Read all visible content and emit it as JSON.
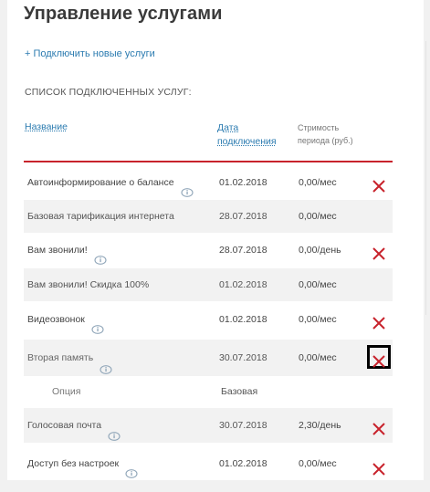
{
  "page": {
    "title": "Управление услугами",
    "add_link": "+ Подключить новые услуги",
    "list_title": "СПИСОК ПОДКЛЮЧЕННЫХ УСЛУГ:"
  },
  "table": {
    "headers": {
      "name": "Название",
      "date": "Дата подключения",
      "cost": "Стримость периода (руб.)"
    },
    "rows": [
      {
        "name": "Автоинформирование о балансе",
        "date": "01.02.2018",
        "cost": "0,00/мес"
      },
      {
        "name": "Базовая тарификация интернета",
        "date": "28.07.2018",
        "cost": "0,00/мес"
      },
      {
        "name": "Вам звонили!",
        "date": "28.07.2018",
        "cost": "0,00/день"
      },
      {
        "name": "Вам звонили! Скидка 100%",
        "date": "01.02.2018",
        "cost": "0,00/мес"
      },
      {
        "name": "Видеозвонок",
        "date": "01.02.2018",
        "cost": "0,00/мес"
      },
      {
        "name": "Вторая память",
        "date": "30.07.2018",
        "cost": "0,00/мес"
      },
      {
        "name": "Голосовая почта",
        "date": "30.07.2018",
        "cost": "2,30/день"
      },
      {
        "name": "Доступ без настроек",
        "date": "01.02.2018",
        "cost": "0,00/мес"
      }
    ],
    "option_row": {
      "label": "Опция",
      "value": "Базовая"
    }
  },
  "colors": {
    "accent_red": "#c8232c",
    "link_blue": "#2b7bb0"
  }
}
